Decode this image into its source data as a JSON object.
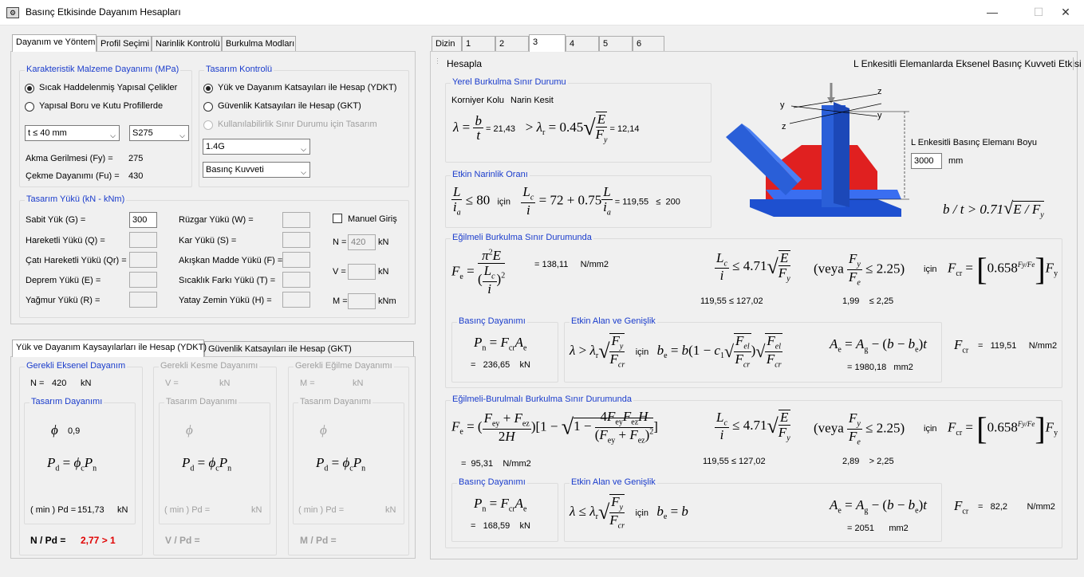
{
  "window": {
    "title": "Basınç Etkisinde Dayanım Hesapları",
    "minimize": "—",
    "maximize": "☐",
    "close": "✕"
  },
  "left_tabs": [
    "Dayanım ve Yöntem",
    "Profil Seçimi",
    "Narinlik Kontrolü",
    "Burkulma Modları"
  ],
  "material": {
    "title": "Karakteristik Malzeme Dayanımı (MPa)",
    "opt1": "Sıcak Haddelenmiş Yapısal Çelikler",
    "opt2": "Yapısal Boru ve Kutu Profillerde",
    "thickness": "t ≤ 40 mm",
    "grade": "S275",
    "fy_label": "Akma Gerilmesi (Fy) =",
    "fy": "275",
    "fu_label": "Çekme Dayanımı (Fu) =",
    "fu": "430"
  },
  "design": {
    "title": "Tasarım Kontrolü",
    "opt1": "Yük ve Dayanım Katsayıları ile Hesap (YDKT)",
    "opt2": "Güvenlik Katsayıları ile Hesap (GKT)",
    "opt3": "Kullanılabilirlik Sınır Durumu için Tasarım",
    "combo1": "1.4G",
    "combo2": "Basınç Kuvveti"
  },
  "loads": {
    "title": "Tasarım Yükü (kN - kNm)",
    "g": "Sabit Yük (G) =",
    "g_val": "300",
    "q": "Hareketli Yükü (Q) =",
    "qr": "Çatı Hareketli Yükü (Qr) =",
    "e": "Deprem Yükü (E) =",
    "r": "Yağmur Yükü (R) =",
    "w": "Rüzgar Yükü (W) =",
    "s": "Kar Yükü (S) =",
    "f": "Akışkan Madde Yükü (F) =",
    "t": "Sıcaklık Farkı Yükü (T) =",
    "h": "Yatay Zemin Yükü (H) =",
    "manual": "Manuel Giriş",
    "n_label": "N =",
    "n_val": "420",
    "n_unit": "kN",
    "v_label": "V =",
    "v_unit": "kN",
    "m_label": "M =",
    "m_unit": "kNm"
  },
  "bottom_tabs": [
    "Yük ve Dayanım Kaysayılarları ile Hesap (YDKT)",
    "Güvenlik Katsayıları ile Hesap (GKT)"
  ],
  "req_axial": {
    "title": "Gerekli Eksenel Dayanım",
    "label": "N =",
    "value": "420",
    "unit": "kN",
    "design_title": "Tasarım Dayanımı",
    "phi": "ϕ",
    "phi_val": "0,9",
    "pd_label": "( min ) Pd =",
    "pd": "151,73",
    "pd_unit": "kN",
    "ratio_label": "N / Pd =",
    "ratio": "2,77 > 1"
  },
  "req_shear": {
    "title": "Gerekli Kesme Dayanımı",
    "label": "V =",
    "unit": "kN",
    "design_title": "Tasarım Dayanımı",
    "phi": "ϕ",
    "pd_label": "( min ) Pd =",
    "pd_unit": "kN",
    "ratio_label": "V / Pd ="
  },
  "req_moment": {
    "title": "Gerekli Eğilme Dayanımı",
    "label": "M =",
    "unit": "kN",
    "design_title": "Tasarım Dayanımı",
    "phi": "ϕ",
    "pd_label": "( min ) Pd =",
    "pd_unit": "kN",
    "ratio_label": "M / Pd ="
  },
  "right_tabs": [
    "Dizin",
    "1",
    "2",
    "3",
    "4",
    "5",
    "6"
  ],
  "right_header": {
    "calc": "Hesapla",
    "title": "L Enkesitli Elemanlarda Eksenel Basınç Kuvveti Etkisi"
  },
  "local": {
    "title": "Yerel Burkulma Sınır Durumu",
    "kind": "Korniyer Kolu",
    "kind2": "Narin Kesit",
    "lambda": "21,43",
    "lambda_r": "12,14"
  },
  "slender": {
    "title": "Etkin Narinlik Oranı",
    "kl": "72",
    "value": "119,55",
    "limit": "200",
    "for": "için",
    "le80": "≤ 80"
  },
  "figure": {
    "length_label": "L Enkesitli Basınç Elemanı Boyu",
    "length": "3000",
    "unit": "mm",
    "axes": {
      "y": "y",
      "z": "z"
    }
  },
  "flex": {
    "title": "Eğilmeli Burkulma Sınır Durumunda",
    "fe": "138,11",
    "fe_unit": "N/mm2",
    "cond1": "119,55",
    "cond1_op": "≤",
    "cond1b": "127,02",
    "cond2": "1,99",
    "cond2_op": "≤",
    "cond2b": "2,25",
    "for": "için",
    "comp_title": "Basınç Dayanımı",
    "pn": "236,65",
    "pn_unit": "kN",
    "eff_title": "Etkin Alan ve Genişlik",
    "ae": "1980,18",
    "ae_unit": "mm2",
    "fcr": "119,51",
    "fcr_unit": "N/mm2"
  },
  "torsional": {
    "title": "Eğilmeli-Burulmalı Burkulma Sınır Durumunda",
    "fe": "95,31",
    "fe_unit": "N/mm2",
    "cond1": "119,55",
    "cond1_op": "≤",
    "cond1b": "127,02",
    "cond2": "2,89",
    "cond2_op": ">",
    "cond2b": "2,25",
    "for": "için",
    "comp_title": "Basınç Dayanımı",
    "pn": "168,59",
    "pn_unit": "kN",
    "eff_title": "Etkin Alan ve Genişlik",
    "ae": "2051",
    "ae_unit": "mm2",
    "fcr": "82,2",
    "fcr_unit": "N/mm2"
  },
  "colors": {
    "blue_title": "#1a3ccc",
    "red": "#e00000",
    "profile_blue": "#2a5fd8",
    "plate_red": "#e02020"
  }
}
